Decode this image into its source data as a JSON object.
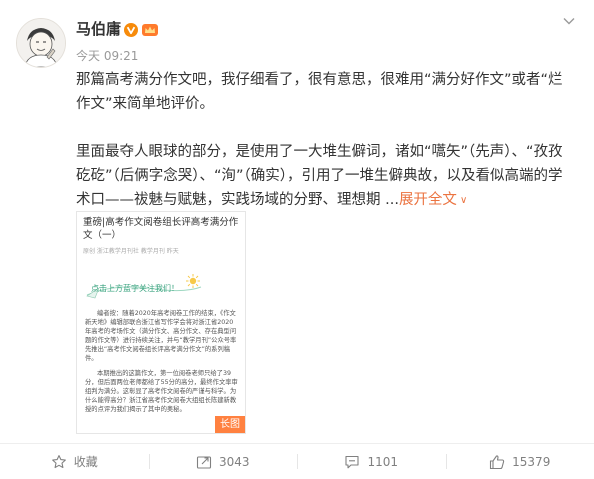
{
  "colors": {
    "accent": "#eb7340",
    "verified": "#f78b0b",
    "member": "#ff7b2c",
    "tag": "#ff8140",
    "muted": "#808080"
  },
  "header": {
    "username": "马伯庸",
    "time": "今天 09:21",
    "verified_icon": "verified-v-icon",
    "member_icon": "crown-icon",
    "menu_icon": "chevron-down-icon"
  },
  "content": {
    "para1": "那篇高考满分作文吧，我仔细看了，很有意思，很难用“满分好作文”或者“烂作文”来简单地评价。",
    "para2": "里面最夺人眼球的部分，是使用了一大堆生僻词，诸如“嚆矢”（先声）、“孜孜矻矻”（后俩字念哭）、“洵”（确实），引用了一堆生僻典故，以及看似高端的学术口——祓魅与赋魅，实践场域的分野、理想期 ...",
    "expand_label": "展开全文"
  },
  "long_image": {
    "title": "重磅|高考作文阅卷组长评高考满分作文（一）",
    "meta": "原创   浙江教学月刊社   教学月刊   昨天",
    "banner": "点击上方蓝字关注我们！",
    "editor_note": "编者按：随着2020年高考阅卷工作的结束，《作文新天地》编辑部联合浙江省写作学会将对浙江省2020年高考的考场作文（满分作文、高分作文、存在典型问题的作文等）进行持续关注，并与“教学月刊”公众号率先推出“高考作文阅卷组长评高考满分作文”的系列稿件。",
    "body": "本期推出的这篇作文，第一位阅卷老师只给了39分，但后面两位老师都给了55分的高分，最终作文率审组判为满分。这彰显了高考作文阅卷的严谨与科学。为什么能得高分？浙江省高考作文阅卷大组组长陈建新教授的点评为我们揭示了其中的奥秘。",
    "tag": "长图"
  },
  "actions": [
    {
      "name": "favorite",
      "icon": "star-icon",
      "label": "收藏"
    },
    {
      "name": "repost",
      "icon": "share-icon",
      "label": "3043"
    },
    {
      "name": "comment",
      "icon": "comment-icon",
      "label": "1101"
    },
    {
      "name": "like",
      "icon": "thumbs-up-icon",
      "label": "15379"
    }
  ]
}
